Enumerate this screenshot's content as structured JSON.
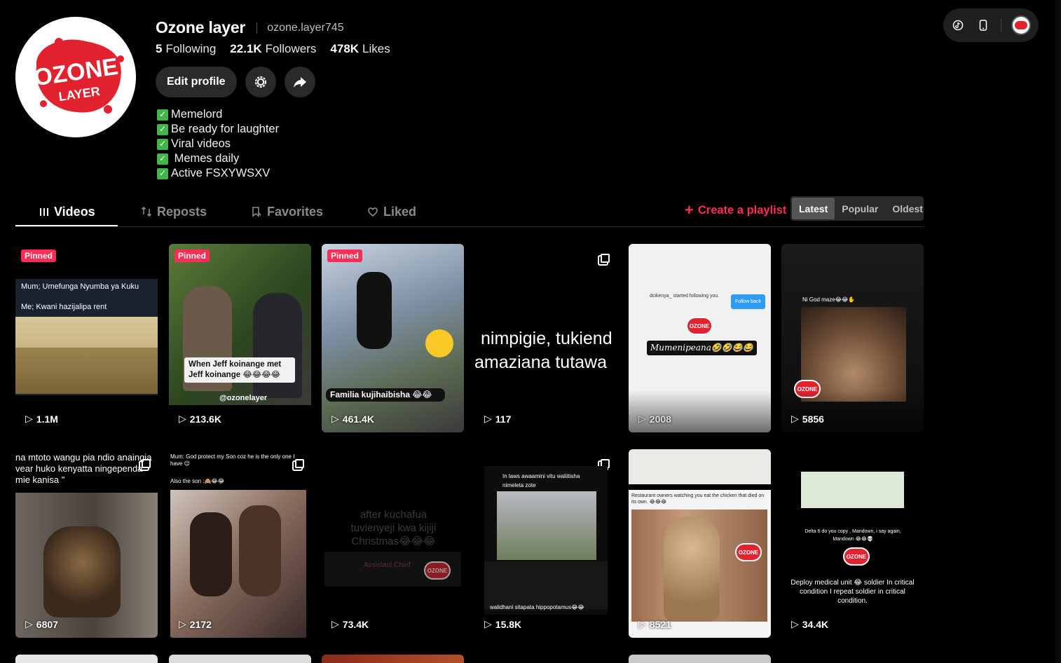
{
  "profile": {
    "display_name": "Ozone layer",
    "handle": "ozone.layer745",
    "avatar_text_top": "OZONE",
    "avatar_text_bottom": "LAYER",
    "stats": [
      {
        "value": "5",
        "label": "Following"
      },
      {
        "value": "22.1K",
        "label": "Followers"
      },
      {
        "value": "478K",
        "label": "Likes"
      }
    ],
    "edit_label": "Edit profile",
    "bio": [
      "Memelord",
      "Be ready for laughter",
      "Viral videos",
      " Memes daily",
      "Active FSXYWSXV"
    ]
  },
  "tabs": [
    {
      "label": "Videos",
      "icon": "grid-icon"
    },
    {
      "label": "Reposts",
      "icon": "repost-icon"
    },
    {
      "label": "Favorites",
      "icon": "bookmark-icon"
    },
    {
      "label": "Liked",
      "icon": "heart-icon"
    }
  ],
  "create_playlist": "Create a playlist",
  "sort": [
    "Latest",
    "Popular",
    "Oldest"
  ],
  "pinned_label": "Pinned",
  "videos": [
    {
      "views": "1.1M",
      "caption": "Mum; Umefunga Nyumba ya Kuku",
      "caption2": "Me; Kwani hazijalipa rent"
    },
    {
      "views": "213.6K",
      "caption": "When Jeff koinange met Jeff koinange 😂😂😂😂",
      "watermark": "@ozonelayer"
    },
    {
      "views": "461.4K",
      "caption": "Familia kujihaibisha 😂😂"
    },
    {
      "views": "117",
      "caption": "nimpigie, tukiend",
      "caption2": "amaziana tutawa"
    },
    {
      "views": "2008",
      "caption": "dcikenya_ started following you.",
      "caption2": "Mumenipeana🤣🤣😂😂",
      "follow": "Follow back"
    },
    {
      "views": "5856",
      "caption": "Ni God maze😂😂✋"
    },
    {
      "views": "6807",
      "caption": "na mtoto wangu pia ndio anaingia",
      "caption2": "vear huko kenyatta ningependa",
      "caption3": "mie kanisa \""
    },
    {
      "views": "2172",
      "caption": "Mum: God protect my Son coz he is the only one I have 😉",
      "caption2": "Also the son :🙈😂😂"
    },
    {
      "views": "73.4K",
      "caption": "after kuchafua tuvienyeji kwa kijiji Christmas😂😂😂",
      "caption2": "Assistant Chief"
    },
    {
      "views": "15.8K",
      "caption": "In laws awaamini vitu waliitisha nimeleta zote",
      "caption2": "walidhani sitapata hippopotamus😂😂"
    },
    {
      "views": "8521",
      "caption": "Restaurant owners watching you eat the chicken that died on its own. 😂😂😂"
    },
    {
      "views": "34.4K",
      "caption": "Delta 6 do you copy , Mandown, i say again, Mandown 😂😂💀",
      "caption2": "Deploy medical unit 😂 soldier In critical condition I repeat soldier in critical condition."
    }
  ],
  "colors": {
    "accent": "#fe2c55",
    "brand": "#e2222f",
    "check": "#43b649"
  }
}
